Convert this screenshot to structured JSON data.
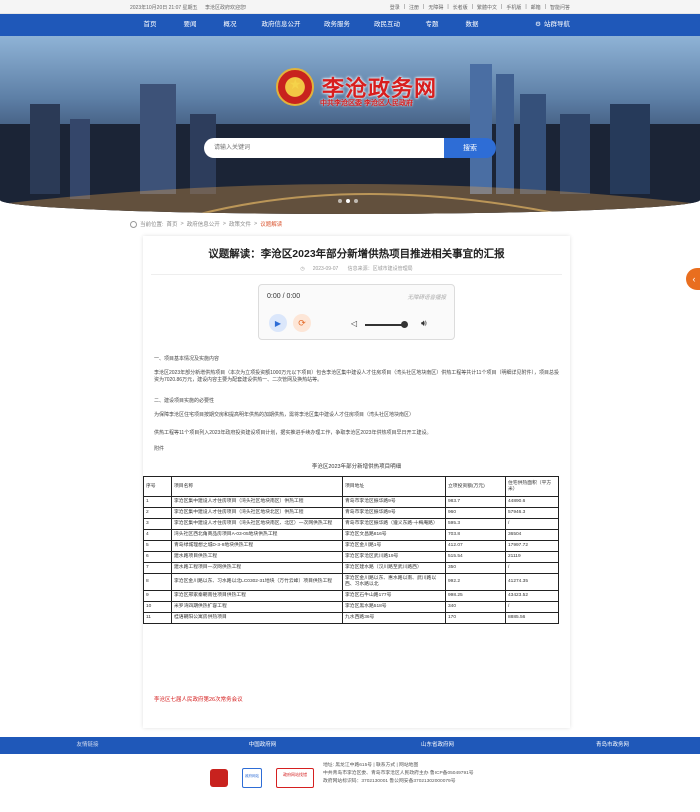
{
  "topbar": {
    "datetime": "2023年10月20日 21:07 星期五",
    "welcome": "李沧区政府欢迎您!",
    "links": [
      "登录",
      "注册",
      "无障碍",
      "长者版",
      "繁體中文",
      "手机版",
      "邮箱",
      "智能问答"
    ]
  },
  "nav": {
    "items": [
      "首页",
      "要闻",
      "概况",
      "政府信息公开",
      "政务服务",
      "政民互动",
      "专题",
      "数据"
    ],
    "site_nav": "站群导航"
  },
  "banner": {
    "site_name": "李沧政务网",
    "subtitle": "中共李沧区委 李沧区人民政府",
    "search_placeholder": "请输入关键词",
    "search_button": "搜索"
  },
  "breadcrumb": {
    "label": "当前位置:",
    "items": [
      "首页",
      "政府信息公开",
      "政策文件"
    ],
    "current": "议题解读"
  },
  "article": {
    "title": "议题解读：李沧区2023年部分新增供热项目推进相关事宜的汇报",
    "date": "2023-09-07",
    "source": "信息来源：区城市建设管理局",
    "player": {
      "time": "0:00 / 0:00",
      "tip": "无障碍语音播报"
    },
    "paragraphs": [
      "一、项目基本情况及实施内容",
      "李沧区2023年部分新增供热项目（本次为立项投资额1000万元以下项目）包含李沧区集中建设人才住房项目（湾头社区地块南区）供热工程等共计11个项目（明细详见附件），项目总投资为7020.86万元，建设内容主要为配套建设供热一、二次管网及换热站等。",
      "二、建设项目实施的必要性",
      "为保障李沧区住宅项目按期交房和提高明年供热的加期供热，需将李沧区集中建设人才住房项目（湾头社区地块南区）",
      "供热工程等11个项目列入2023年政府投资建设项目计划，据实推进手续办理工作，争取李沧区2023年供热项目早日开工建设。",
      "附件"
    ],
    "footnote": "李沧区七届人民政府第26次常务会议"
  },
  "chart_data": {
    "type": "table",
    "title": "李沧区2023年部分新增供热项目明细",
    "columns": [
      "序号",
      "项目名称",
      "项目地址",
      "立项投资额(万元)",
      "住宅供热面积（平方米）"
    ],
    "rows": [
      [
        "1",
        "李沧区集中建设人才住房项目（湾头社区地块南区）供热工程",
        "青岛市李沧区振华路9号",
        "983.7",
        "44890.6"
      ],
      [
        "2",
        "李沧区集中建设人才住房项目（湾头社区地块北区）供热工程",
        "青岛市李沧区振华路9号",
        "960",
        "57946.3"
      ],
      [
        "3",
        "李沧区集中建设人才住房项目（湾头社区地块南区、北区）一次网供热工程",
        "青岛市李沧区振华路（遵义东路-十梅庵路）",
        "595.3",
        "/"
      ],
      [
        "4",
        "湾头社区西北角商品房项目A-03-05地块供热工程",
        "李沧区文昌路816号",
        "703.8",
        "36504"
      ],
      [
        "5",
        "青岛绿城理想之城D-3-9地块供热工程",
        "李沧区金川路1号",
        "412.07",
        "17997.72"
      ],
      [
        "6",
        "建水路项目供热工程",
        "李沧区李沧区武川路19号",
        "515.54",
        "21119"
      ],
      [
        "7",
        "建水路工程项目一次网供热工程",
        "李沧区建水路（汉川路至武川路西）",
        "350",
        "/"
      ],
      [
        "8",
        "李沧区金川路以东、习水路以北LC0302-31地块（万竹云峰）项目供热工程",
        "李沧区金川路以东、惠水路以南、武川路以西、习水路以北",
        "992.2",
        "41274.35"
      ],
      [
        "9",
        "李沧区邢家秦朝南住项目供热工程",
        "李沧区石牛山路177号",
        "998.25",
        "43423.52"
      ],
      [
        "10",
        "米罗湾四期供热扩容工程",
        "李沧区黑水路518号",
        "340",
        "/"
      ],
      [
        "11",
        "桂语朝阳公寓房供热项目",
        "九水西路36号",
        "170",
        "8885.56"
      ]
    ]
  },
  "footer": {
    "links": [
      "友情链接",
      "中国政府网",
      "山东省政府网",
      "青岛市政务网"
    ],
    "badge2_label": "政府网站",
    "badge3_label": "政府网站找错",
    "info": [
      "地址: 黑龙江中路615号 | 联系方式 | 网站地图",
      "中共青岛市李沧区委、青岛市李沧区人民政府主办 鲁ICP备05049791号",
      "政府网站标识码：3702130001 鲁公网安备37021302000079号"
    ]
  }
}
